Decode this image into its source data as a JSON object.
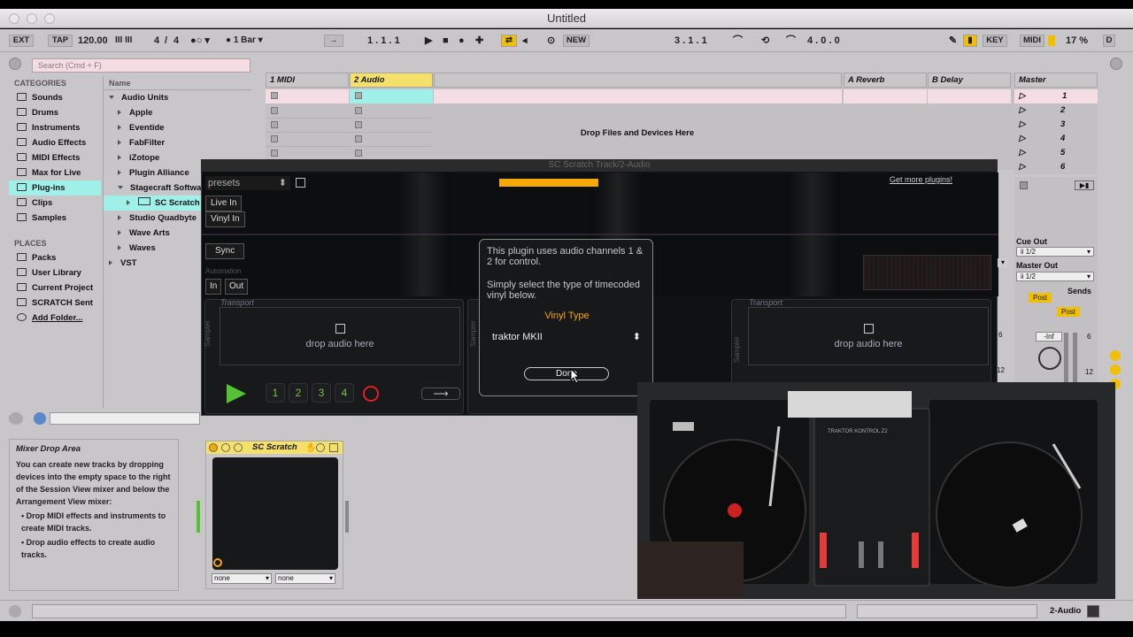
{
  "window": {
    "title": "Untitled"
  },
  "transport": {
    "ext": "EXT",
    "tap": "TAP",
    "tempo": "120.00",
    "meter_num": "4",
    "meter_den": "4",
    "quantize": "1 Bar",
    "position": "1 .   1 .   1",
    "loop_start": "3 .   1 .   1",
    "loop_length": "4 .   0 .   0",
    "new": "NEW",
    "key": "KEY",
    "midi": "MIDI",
    "cpu": "17 %",
    "d": "D"
  },
  "browser": {
    "search_placeholder": "Search (Cmd + F)",
    "categories_header": "CATEGORIES",
    "name_header": "Name",
    "categories": [
      {
        "label": "Sounds",
        "icon": "sounds-icon"
      },
      {
        "label": "Drums",
        "icon": "drums-icon"
      },
      {
        "label": "Instruments",
        "icon": "instruments-icon"
      },
      {
        "label": "Audio Effects",
        "icon": "audio-effects-icon"
      },
      {
        "label": "MIDI Effects",
        "icon": "midi-effects-icon"
      },
      {
        "label": "Max for Live",
        "icon": "max-icon"
      },
      {
        "label": "Plug-ins",
        "icon": "plugins-icon"
      },
      {
        "label": "Clips",
        "icon": "clips-icon"
      },
      {
        "label": "Samples",
        "icon": "samples-icon"
      }
    ],
    "places_header": "PLACES",
    "places": [
      {
        "label": "Packs"
      },
      {
        "label": "User Library"
      },
      {
        "label": "Current Project"
      },
      {
        "label": "SCRATCH Sent"
      },
      {
        "label": "Add Folder..."
      }
    ],
    "names": [
      "Audio Units",
      "Apple",
      "Eventide",
      "FabFilter",
      "iZotope",
      "Plugin Alliance",
      "Stagecraft Softwa",
      "SC Scratch",
      "Studio Quadbyte",
      "Wave Arts",
      "Waves",
      "VST"
    ]
  },
  "session": {
    "tracks": [
      "1 MIDI",
      "2 Audio",
      "A Reverb",
      "B Delay",
      "Master"
    ],
    "drop_text": "Drop Files and Devices Here",
    "scenes": [
      "1",
      "2",
      "3",
      "4",
      "5",
      "6"
    ],
    "cue_out_label": "Cue Out",
    "cue_out_value": "ii 1/2",
    "master_out_label": "Master Out",
    "master_out_value": "ii 1/2",
    "sends_label": "Sends",
    "post": "Post",
    "inf": "-Inf",
    "meter_scale": [
      "6",
      "12"
    ]
  },
  "plugin": {
    "title": "SC Scratch Track/2-Audio",
    "presets": "presets",
    "get_more": "Get more plugins!",
    "live_in": "Live In",
    "vinyl_in": "Vinyl In",
    "sync": "Sync",
    "automation": "Automation",
    "in": "In",
    "out": "Out",
    "transport_label": "Transport",
    "drop_audio": "drop audio here",
    "sampler_label": "Sampler",
    "cue_numbers": [
      "1",
      "2",
      "3",
      "4"
    ],
    "colors": {
      "accent": "#f5a800",
      "green": "#53c234",
      "red": "#e02020"
    }
  },
  "dialog": {
    "text1": "This plugin uses audio channels 1 & 2 for control.",
    "text2": "Simply select the type of timecoded vinyl below.",
    "vinyl_type_label": "Vinyl Type",
    "vinyl_type_value": "traktor MKII",
    "done": "Done"
  },
  "info": {
    "title": "Mixer Drop Area",
    "body": "You can create new tracks by dropping devices into the empty space to the right of the Session View mixer and below the Arrangement View mixer:",
    "bullet1": "Drop MIDI effects and instruments to create MIDI tracks.",
    "bullet2": "Drop audio effects to create audio tracks."
  },
  "device": {
    "title": "SC Scratch",
    "select1": "none",
    "select2": "none"
  },
  "statusbar": {
    "track": "2-Audio"
  },
  "video": {
    "brand": "TRAKTOR KONTROL Z2"
  }
}
